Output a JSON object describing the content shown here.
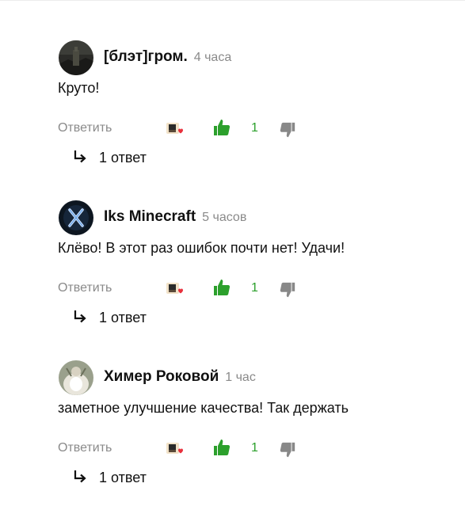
{
  "comments": [
    {
      "author": "[блэт]гром.",
      "time": "4 часа",
      "text": "Круто!",
      "reply_label": "Ответить",
      "likes": "1",
      "replies": "1 ответ",
      "avatar_icon": "dark-landscape-avatar"
    },
    {
      "author": "Iks Minecraft",
      "time": "5 часов",
      "text": "Клёво! В этот раз ошибок почти нет! Удачи!",
      "reply_label": "Ответить",
      "likes": "1",
      "replies": "1 ответ",
      "avatar_icon": "x-letter-avatar"
    },
    {
      "author": "Химер Роковой",
      "time": "1 час",
      "text": "заметное улучшение качества! Так держать",
      "reply_label": "Ответить",
      "likes": "1",
      "replies": "1 ответ",
      "avatar_icon": "white-figure-avatar"
    }
  ],
  "colors": {
    "like_green": "#2ca02c",
    "muted_gray": "#8a8a8a",
    "dislike_gray": "#888888",
    "heart_red": "#e8303c"
  }
}
